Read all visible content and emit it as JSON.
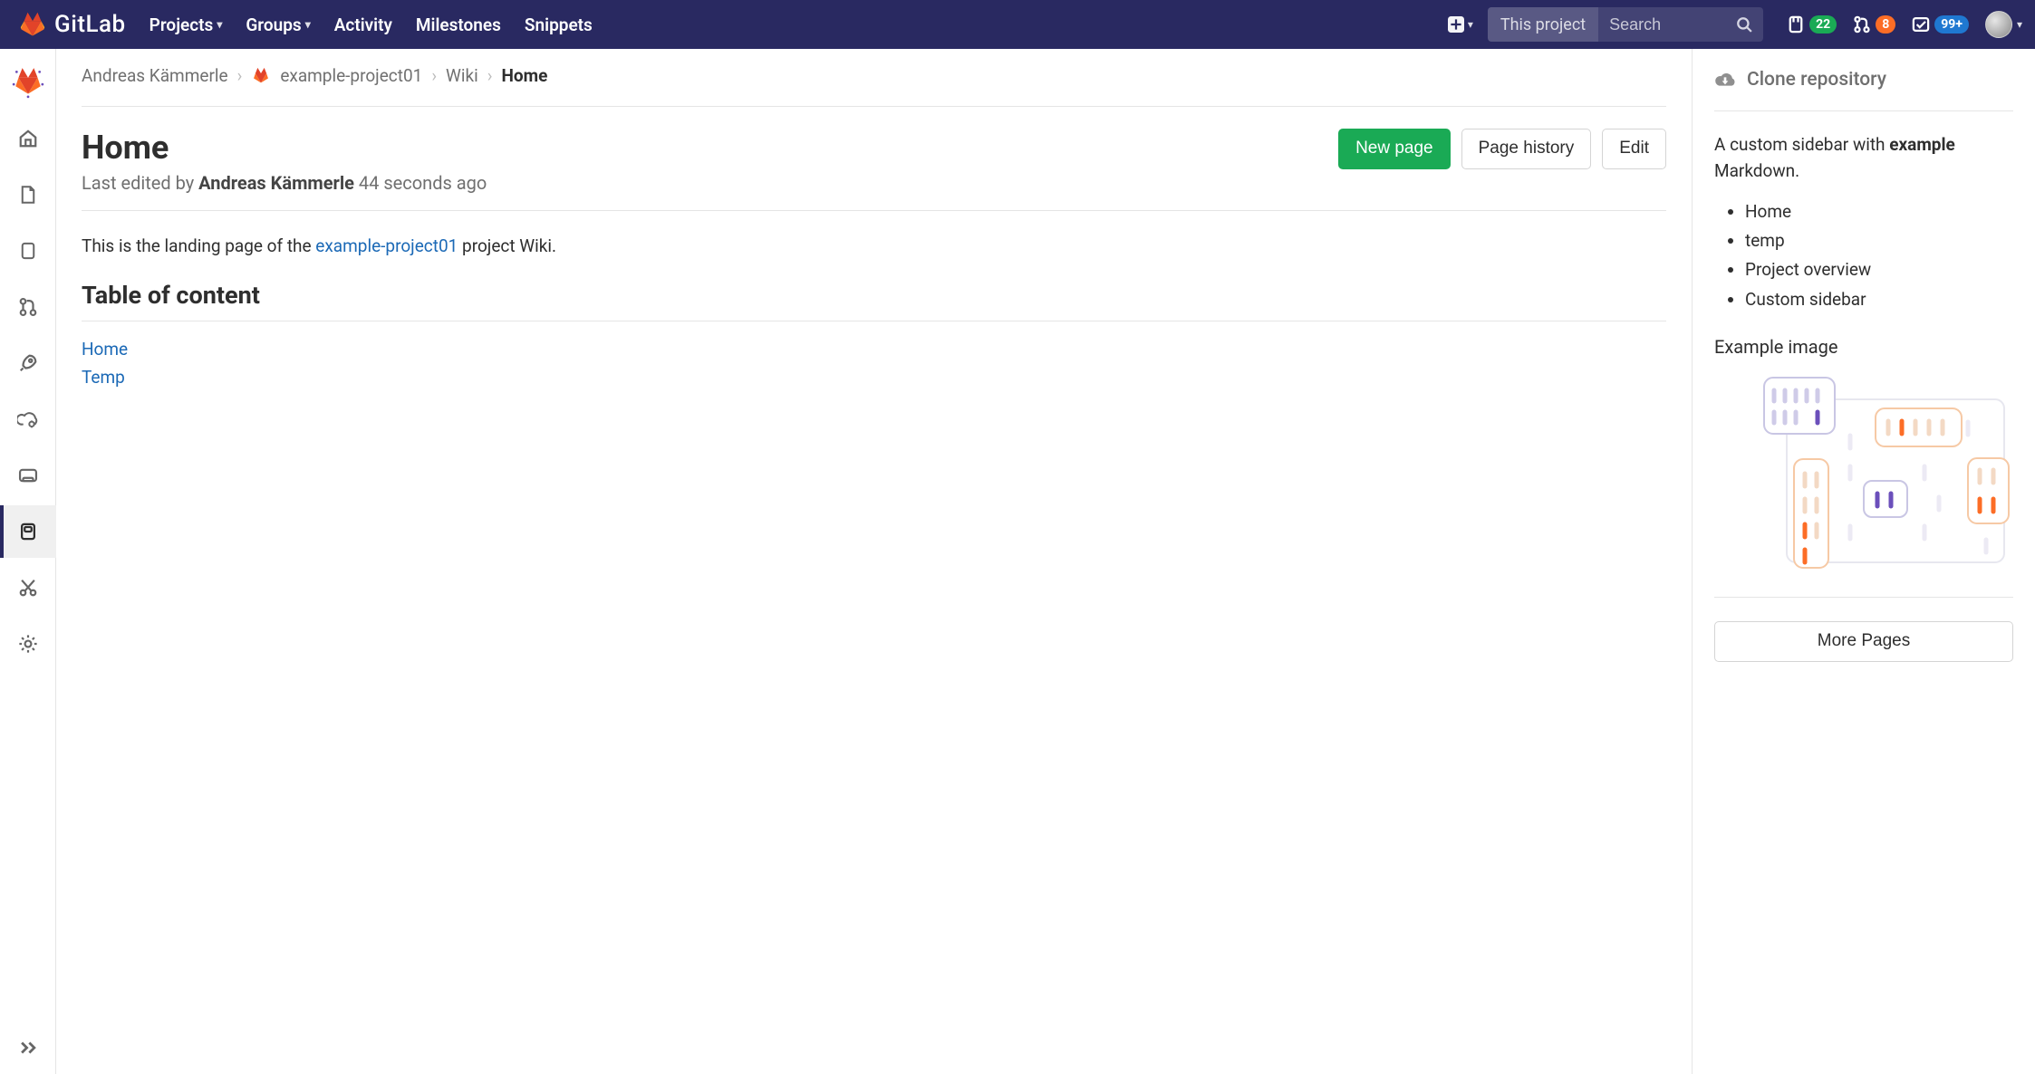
{
  "brand": "GitLab",
  "nav": {
    "projects": "Projects",
    "groups": "Groups",
    "activity": "Activity",
    "milestones": "Milestones",
    "snippets": "Snippets"
  },
  "search": {
    "scope": "This project",
    "placeholder": "Search"
  },
  "counters": {
    "issues": "22",
    "merge_requests": "8",
    "todos": "99+"
  },
  "breadcrumbs": {
    "owner": "Andreas Kämmerle",
    "project": "example-project01",
    "section": "Wiki",
    "current": "Home"
  },
  "page": {
    "title": "Home",
    "last_edited_prefix": "Last edited by ",
    "last_edited_author": "Andreas Kämmerle",
    "last_edited_time": " 44 seconds ago",
    "intro_prefix": "This is the landing page of the ",
    "intro_link": "example-project01",
    "intro_suffix": " project Wiki.",
    "toc_heading": "Table of content",
    "toc": {
      "home": "Home",
      "temp": "Temp"
    }
  },
  "actions": {
    "new_page": "New page",
    "page_history": "Page history",
    "edit": "Edit"
  },
  "sidebar": {
    "clone": "Clone repository",
    "desc_prefix": "A custom sidebar with ",
    "desc_bold": "example",
    "desc_suffix": " Markdown.",
    "links": {
      "home": "Home",
      "temp": "temp",
      "overview": "Project overview",
      "custom": "Custom sidebar"
    },
    "image_heading": "Example image",
    "more": "More Pages"
  }
}
